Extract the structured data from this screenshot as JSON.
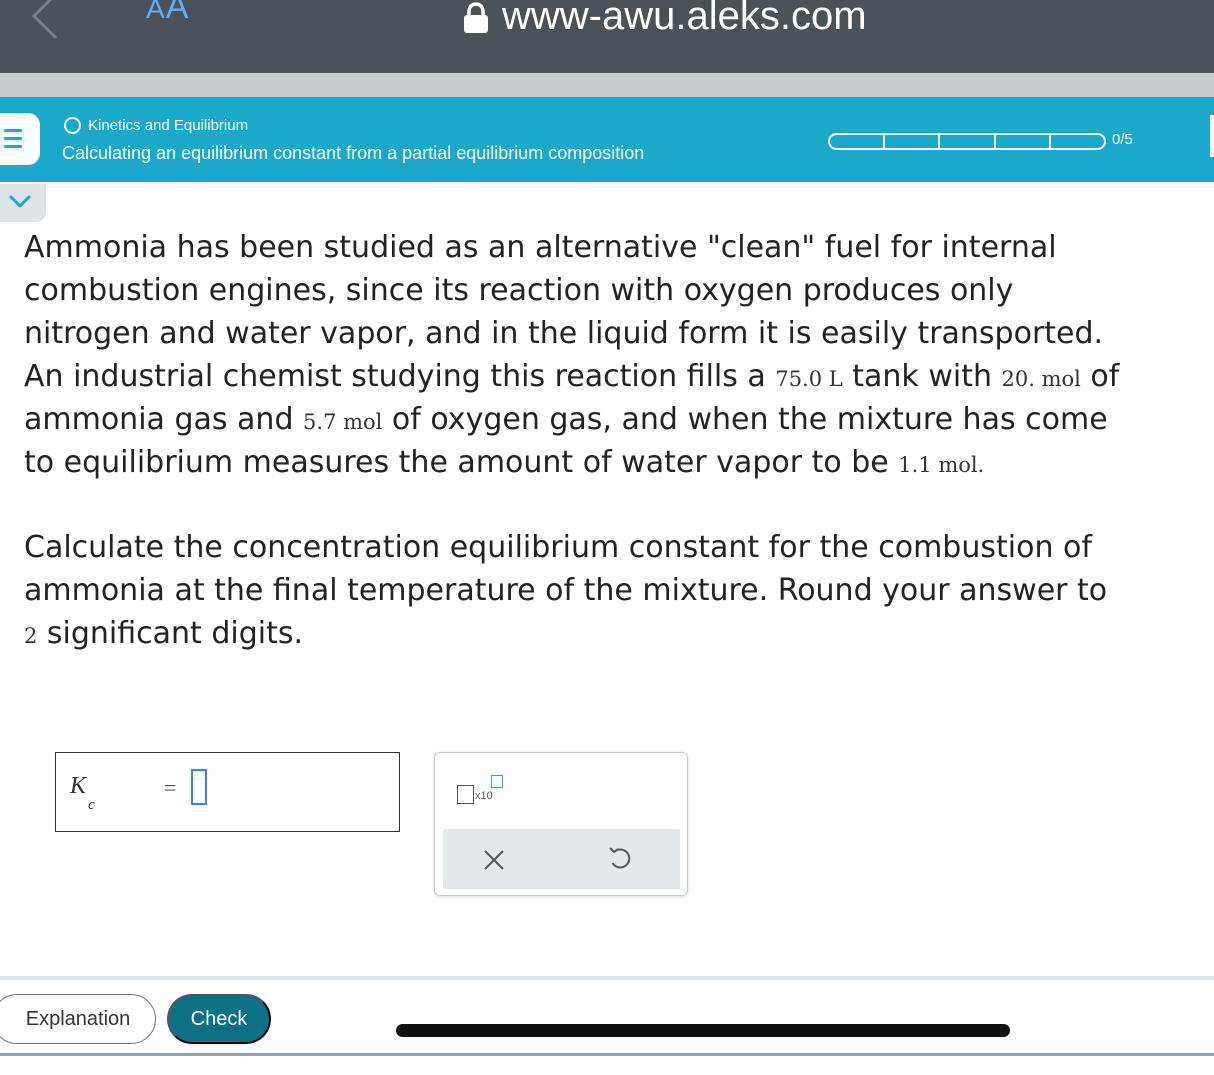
{
  "browser": {
    "text_size_label_small": "A",
    "text_size_label_large": "A",
    "url": "www-awu.aleks.com"
  },
  "header": {
    "topic": "Kinetics and Equilibrium",
    "lesson_title": "Calculating an equilibrium constant from a partial equilibrium composition",
    "progress": {
      "completed": 0,
      "total": 5,
      "label": "0/5"
    }
  },
  "problem": {
    "line1": "Ammonia has been studied as an alternative \"clean\" fuel for internal",
    "line2": "combustion engines, since its reaction with oxygen produces only",
    "line3": "nitrogen and water vapor, and in the liquid form it is easily transported.",
    "line4_a": "An industrial chemist studying this reaction fills a ",
    "tank_volume": "75.0 L",
    "line4_b": " tank with ",
    "ammonia_amount": "20. mol",
    "line4_c": " of",
    "line5_a": "ammonia gas and ",
    "oxygen_amount": "5.7 mol",
    "line5_b": " of oxygen gas, and when the mixture has come",
    "line6_a": "to equilibrium measures the amount of water vapor to be ",
    "water_amount": "1.1 mol.",
    "question_line1": "Calculate the concentration equilibrium constant for the combustion of",
    "question_line2": "ammonia at the final temperature of the mixture. Round your answer to",
    "sig_digits": "2",
    "question_line3_b": " significant digits."
  },
  "answer": {
    "symbol": "K",
    "subscript": "c",
    "equals": "=",
    "value": ""
  },
  "keypad": {
    "sci_notation_times": "x10",
    "clear_symbol": "×"
  },
  "footer": {
    "explanation_label": "Explanation",
    "check_label": "Check"
  },
  "colors": {
    "header_teal": "#1aa9c9",
    "check_button": "#0d7185",
    "browser_bar": "#4b5257",
    "url_accent": "#5ab0ff",
    "input_border": "#3d7ff2"
  }
}
